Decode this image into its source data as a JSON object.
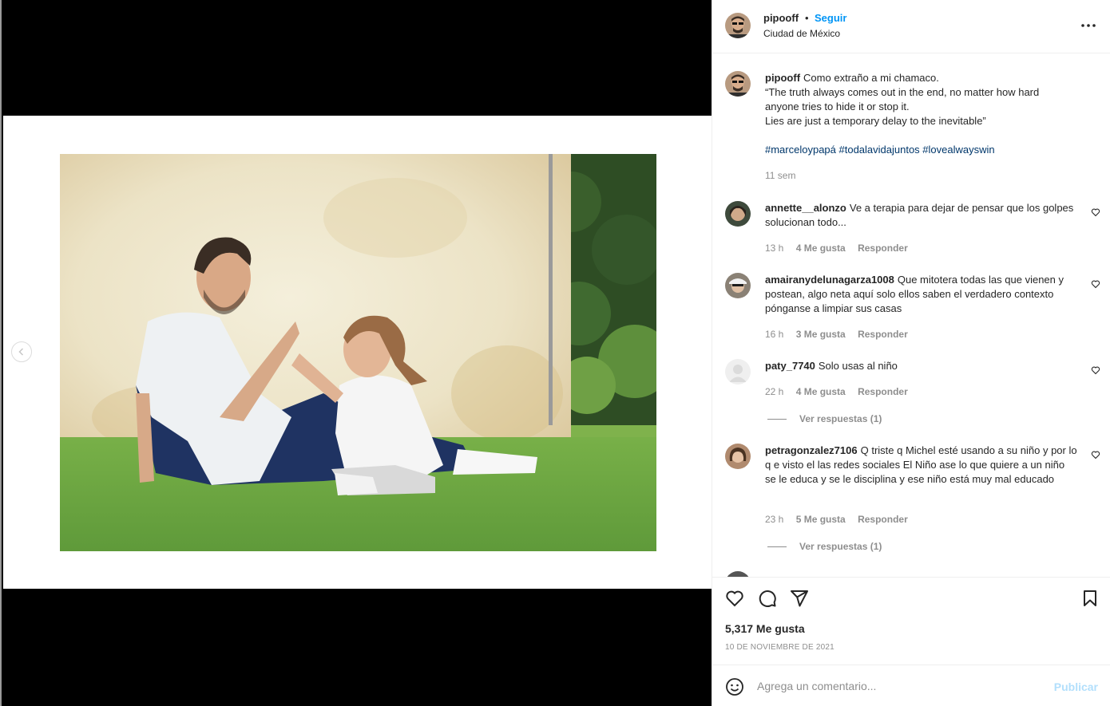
{
  "header": {
    "username": "pipooff",
    "separator": "•",
    "follow_label": "Seguir",
    "location": "Ciudad de México",
    "more_icon": "more-horizontal-icon"
  },
  "caption": {
    "username": "pipooff",
    "lines": [
      "Como extraño a mi chamaco.",
      "“The truth always comes out in the end, no matter how hard anyone tries to hide it or stop it.",
      "Lies are just a temporary delay to the inevitable”"
    ],
    "hashtags": "#marceloypapá #todalavidajuntos #lovealwayswin",
    "time": "11 sem"
  },
  "comments": [
    {
      "username": "annette__alonzo",
      "text": "Ve a terapia para dejar de pensar que los golpes solucionan todo...",
      "time": "13 h",
      "likes": "4 Me gusta",
      "reply": "Responder",
      "avatar_color": "#3e4a3c"
    },
    {
      "username": "amairanydelunagarza1008",
      "text": "Que mitotera todas las que vienen y postean, algo neta aquí solo ellos saben el verdadero contexto pónganse a limpiar sus casas",
      "time": "16 h",
      "likes": "3 Me gusta",
      "reply": "Responder",
      "avatar_color": "#8a8175"
    },
    {
      "username": "paty_7740",
      "text": "Solo usas al niño",
      "time": "22 h",
      "likes": "4 Me gusta",
      "reply": "Responder",
      "replies": "Ver respuestas (1)",
      "avatar_color": "#dbdbdb"
    },
    {
      "username": "petragonzalez7106",
      "text": "Q triste q Michel esté usando a su niño y por lo q e visto el las redes sociales El Niño ase lo que quiere a un niño se le educa y se le disciplina y ese niño está muy mal educado",
      "time": "23 h",
      "likes": "5 Me gusta",
      "reply": "Responder",
      "replies": "Ver respuestas (1)",
      "avatar_color": "#b08a6e"
    }
  ],
  "actions": {
    "likes": "5,317 Me gusta",
    "date": "10 DE NOVIEMBRE DE 2021"
  },
  "add_comment": {
    "placeholder": "Agrega un comentario...",
    "publish_label": "Publicar"
  },
  "colors": {
    "link": "#0095f6",
    "hashtag": "#00376b",
    "muted": "#8e8e8e",
    "publish_disabled": "#b2dffc"
  }
}
